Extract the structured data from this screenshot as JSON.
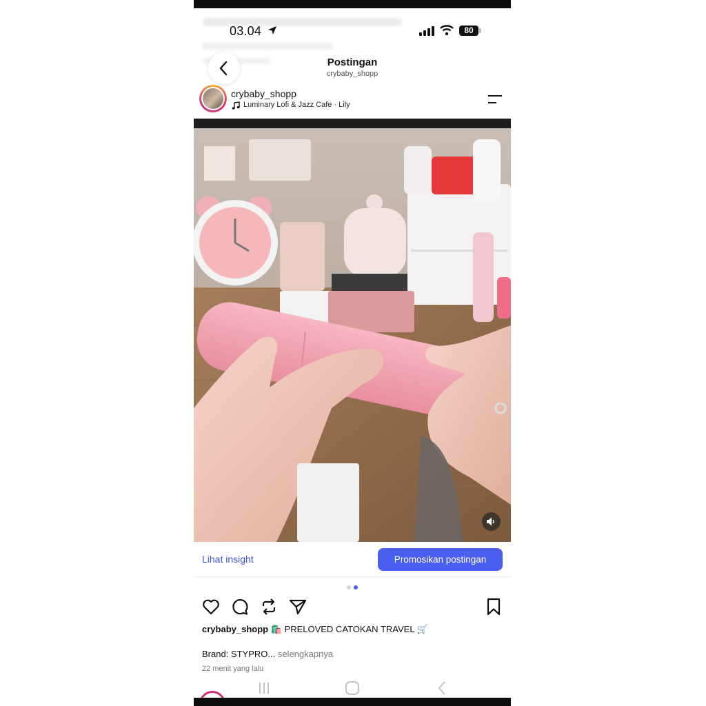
{
  "status_bar": {
    "time": "03.04",
    "battery": "80"
  },
  "header": {
    "title": "Postingan",
    "subtitle": "crybaby_shopp"
  },
  "post": {
    "username": "crybaby_shopp",
    "music": "Luminary Lofi & Jazz Cafe · Lily",
    "insight_label": "Lihat insight",
    "promote_label": "Promosikan postingan",
    "carousel": {
      "count": 2,
      "active": 2
    },
    "caption_user": "crybaby_shopp",
    "caption_text": "🛍️ PRELOVED CATOKAN TRAVEL 🛒",
    "brand_text": "Brand: STYPRO...",
    "more_label": "selengkapnya",
    "time_ago": "22 menit yang lalu"
  },
  "icons": [
    "back-icon",
    "location-arrow-icon",
    "signal-icon",
    "wifi-icon",
    "menu-icon",
    "music-note-icon",
    "volume-icon",
    "heart-icon",
    "comment-icon",
    "repost-icon",
    "share-icon",
    "bookmark-icon"
  ],
  "colors": {
    "accent": "#4a5ef0",
    "link": "#3d56d8",
    "product_pink": "#f4a3b3"
  }
}
